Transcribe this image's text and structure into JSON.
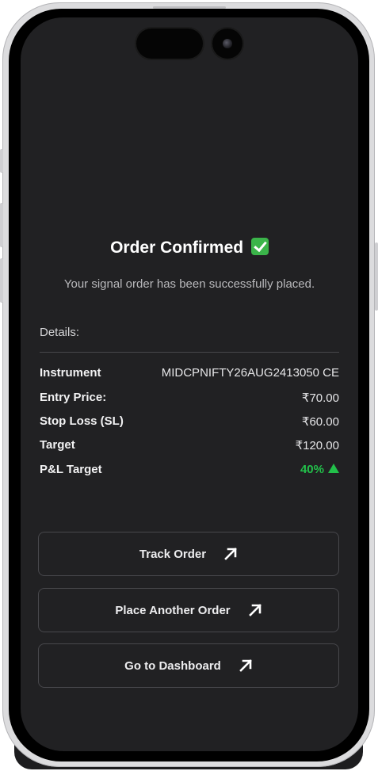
{
  "header": {
    "title": "Order Confirmed",
    "subtitle": "Your signal order has been successfully placed."
  },
  "details": {
    "heading": "Details:",
    "rows": [
      {
        "label": "Instrument",
        "value": "MIDCPNIFTY26AUG2413050 CE"
      },
      {
        "label": "Entry Price:",
        "value": "₹70.00"
      },
      {
        "label": "Stop Loss (SL)",
        "value": "₹60.00"
      },
      {
        "label": "Target",
        "value": "₹120.00"
      },
      {
        "label": "P&L Target",
        "value": "40%"
      }
    ]
  },
  "actions": {
    "track_order": "Track Order",
    "place_another": "Place Another Order",
    "dashboard": "Go to Dashboard"
  },
  "colors": {
    "screen_bg": "#212123",
    "positive": "#22c04a",
    "confirm_check": "#3bb54a"
  },
  "icons": [
    "check-mark-icon",
    "up-triangle-icon",
    "arrow-up-right-icon"
  ]
}
